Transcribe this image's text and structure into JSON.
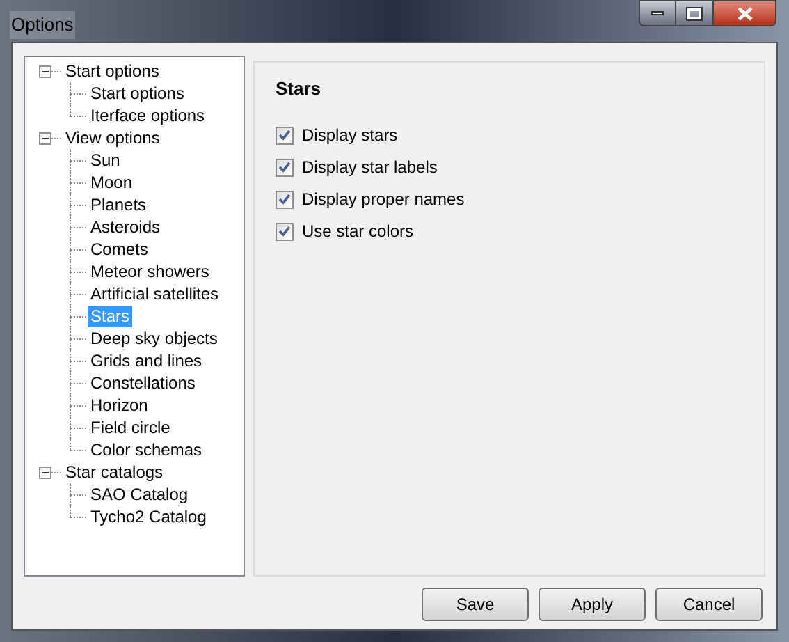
{
  "window": {
    "title": "Options"
  },
  "tree": [
    {
      "label": "Start options",
      "expanded": true,
      "selected": false,
      "children": [
        {
          "label": "Start options",
          "selected": false
        },
        {
          "label": "Iterface options",
          "selected": false
        }
      ]
    },
    {
      "label": "View options",
      "expanded": true,
      "selected": false,
      "children": [
        {
          "label": "Sun",
          "selected": false
        },
        {
          "label": "Moon",
          "selected": false
        },
        {
          "label": "Planets",
          "selected": false
        },
        {
          "label": "Asteroids",
          "selected": false
        },
        {
          "label": "Comets",
          "selected": false
        },
        {
          "label": "Meteor showers",
          "selected": false
        },
        {
          "label": "Artificial satellites",
          "selected": false
        },
        {
          "label": "Stars",
          "selected": true
        },
        {
          "label": "Deep sky objects",
          "selected": false
        },
        {
          "label": "Grids and lines",
          "selected": false
        },
        {
          "label": "Constellations",
          "selected": false
        },
        {
          "label": "Horizon",
          "selected": false
        },
        {
          "label": "Field circle",
          "selected": false
        },
        {
          "label": "Color schemas",
          "selected": false
        }
      ]
    },
    {
      "label": "Star catalogs",
      "expanded": true,
      "selected": false,
      "children": [
        {
          "label": "SAO Catalog",
          "selected": false
        },
        {
          "label": "Tycho2 Catalog",
          "selected": false
        }
      ]
    }
  ],
  "panel": {
    "title": "Stars",
    "options": [
      {
        "label": "Display stars",
        "checked": true
      },
      {
        "label": "Display star labels",
        "checked": true
      },
      {
        "label": "Display proper names",
        "checked": true
      },
      {
        "label": "Use star colors",
        "checked": true
      }
    ]
  },
  "buttons": [
    "Save",
    "Apply",
    "Cancel"
  ]
}
